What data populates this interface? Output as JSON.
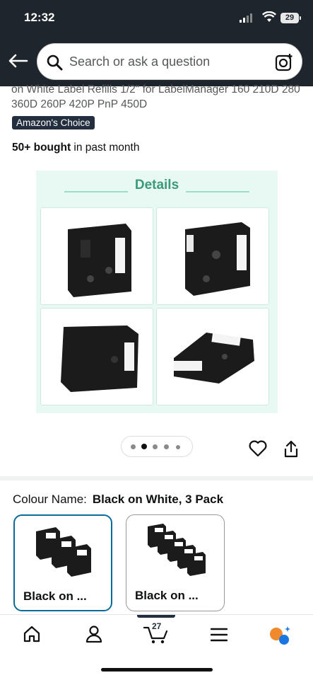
{
  "status_bar": {
    "time": "12:32",
    "battery": "29"
  },
  "search": {
    "placeholder": "Search or ask a question"
  },
  "product": {
    "title_fragment": "on White Label Refills 1/2\" for LabelManager 160 210D 280 360D 260P 420P PnP 450D",
    "badge": "Amazon's Choice",
    "bought_count": "50+ bought",
    "bought_suffix": " in past month",
    "gallery_title": "Details",
    "image_count": 5,
    "active_image_index": 1
  },
  "variation": {
    "label": "Colour Name:",
    "selected": "Black on White, 3 Pack",
    "options": [
      {
        "label": "Black on ...",
        "selected": true
      },
      {
        "label": "Black on ...",
        "selected": false
      }
    ]
  },
  "bottom_nav": {
    "cart_count": "27",
    "items": [
      "home-icon",
      "account-icon",
      "cart-icon",
      "menu-icon",
      "rufus-icon"
    ]
  },
  "colors": {
    "header_bg": "#1f252d",
    "selected_border": "#0a6b9b",
    "badge_bg": "#232f3e",
    "details_green": "#3a9a7a"
  }
}
